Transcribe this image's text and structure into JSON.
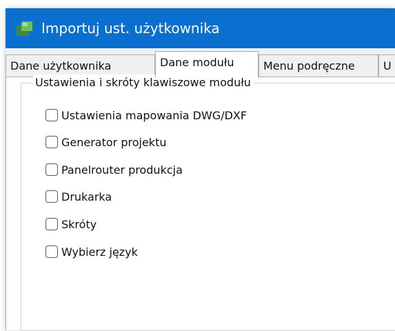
{
  "window": {
    "title": "Importuj ust. użytkownika",
    "title_bar_color": "#0a6fcf",
    "icon": "app-puzzle-icon"
  },
  "tabs": [
    {
      "label": "Dane użytkownika",
      "active": false
    },
    {
      "label": "Dane modułu",
      "active": true
    },
    {
      "label": "Menu podręczne",
      "active": false
    },
    {
      "label": "U",
      "active": false
    }
  ],
  "group": {
    "title": "Ustawienia i skróty klawiszowe modułu",
    "items": [
      {
        "label": "Ustawienia mapowania DWG/DXF",
        "checked": false
      },
      {
        "label": "Generator projektu",
        "checked": false
      },
      {
        "label": "Panelrouter produkcja",
        "checked": false
      },
      {
        "label": "Drukarka",
        "checked": false
      },
      {
        "label": "Skróty",
        "checked": false
      },
      {
        "label": "Wybierz język",
        "checked": false
      }
    ]
  }
}
